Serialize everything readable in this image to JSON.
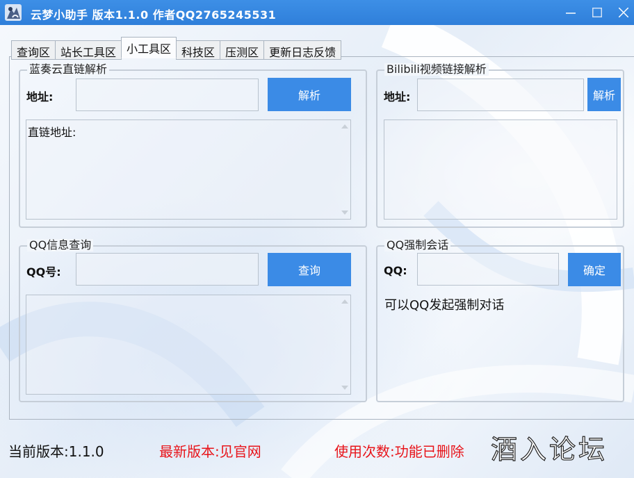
{
  "window": {
    "title": "云梦小助手 版本1.1.0 作者QQ2765245531"
  },
  "tabs": [
    {
      "label": "查询区",
      "active": false
    },
    {
      "label": "站长工具区",
      "active": false
    },
    {
      "label": "小工具区",
      "active": true
    },
    {
      "label": "科技区",
      "active": false
    },
    {
      "label": "压测区",
      "active": false
    },
    {
      "label": "更新日志反馈",
      "active": false
    }
  ],
  "lanzou": {
    "title": "蓝奏云直链解析",
    "address_label": "地址:",
    "address_value": "",
    "parse_button": "解析",
    "result_text": "直链地址:"
  },
  "bilibili": {
    "title": "Bilibili视频链接解析",
    "address_label": "地址:",
    "address_value": "",
    "parse_button": "解析",
    "result_text": ""
  },
  "qqinfo": {
    "title": "QQ信息查询",
    "qq_label": "QQ号:",
    "qq_value": "",
    "query_button": "查询",
    "result_text": ""
  },
  "qqchat": {
    "title": "QQ强制会话",
    "qq_label": "QQ:",
    "qq_value": "",
    "confirm_button": "确定",
    "hint": "可以QQ发起强制对话"
  },
  "status": {
    "current_version": "当前版本:1.1.0",
    "latest_version": "最新版本:见官网",
    "usage_count": "使用次数:功能已删除"
  },
  "watermark": "酒入论坛",
  "colors": {
    "titlebar": "#2f7fda",
    "button": "#3b8be6",
    "status_red": "#e8141a"
  }
}
